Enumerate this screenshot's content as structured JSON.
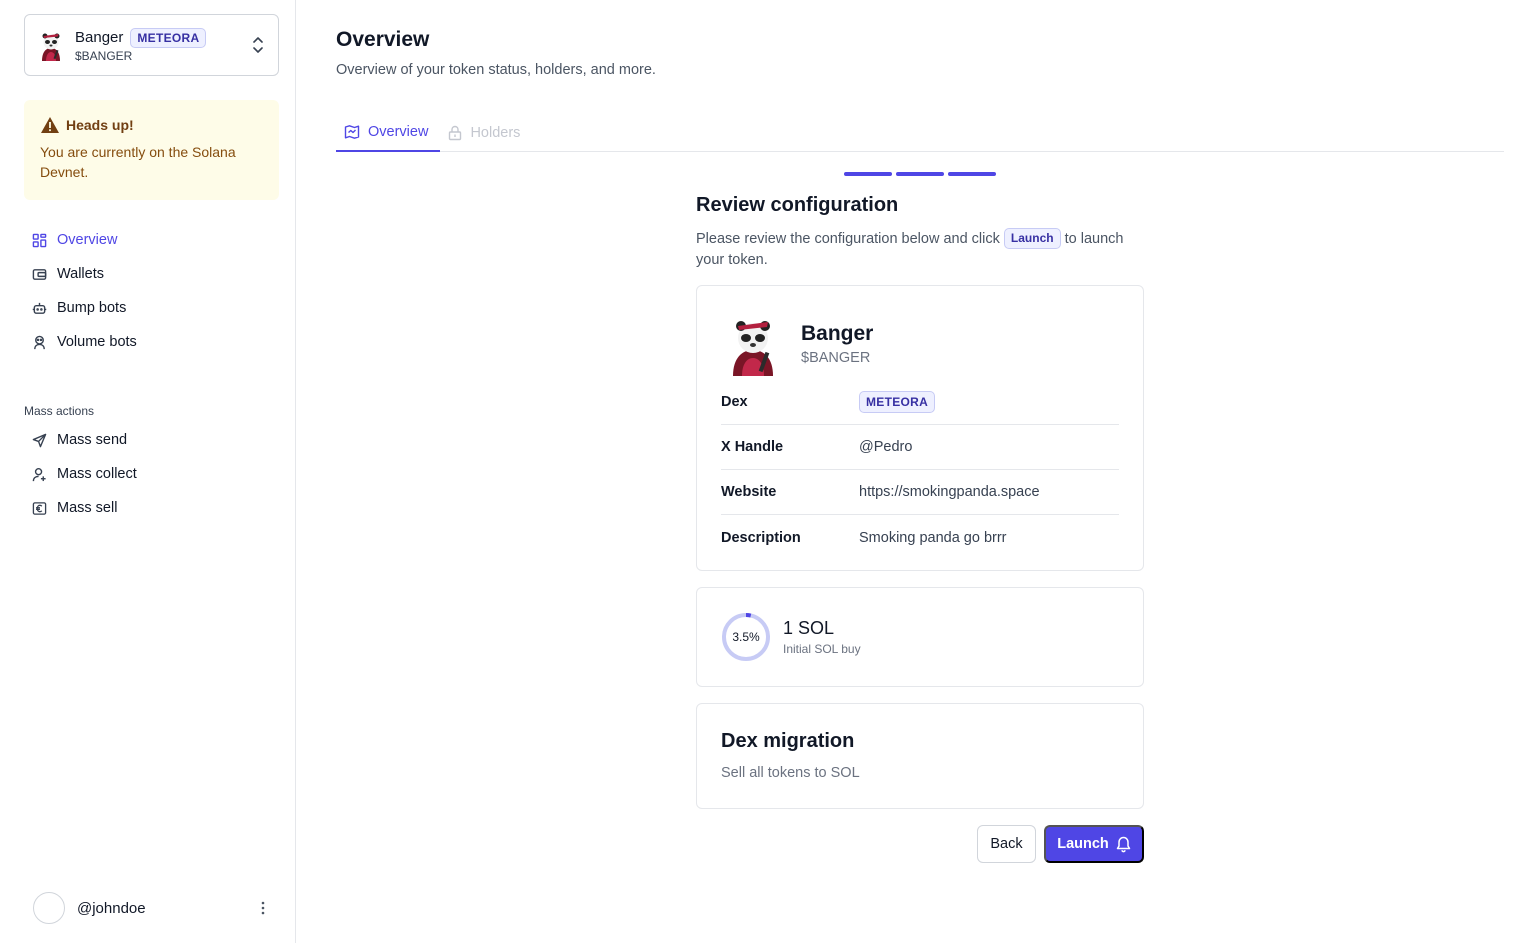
{
  "token": {
    "name": "Banger",
    "symbol": "$BANGER",
    "dex_badge": "METEORA"
  },
  "alert": {
    "title": "Heads up!",
    "body": "You are currently on the Solana Devnet."
  },
  "nav": {
    "items": [
      {
        "label": "Overview",
        "icon": "dashboard-icon",
        "active": true
      },
      {
        "label": "Wallets",
        "icon": "wallet-icon"
      },
      {
        "label": "Bump bots",
        "icon": "bot-icon"
      },
      {
        "label": "Volume bots",
        "icon": "volume-bot-icon"
      }
    ],
    "section_label": "Mass actions",
    "mass_items": [
      {
        "label": "Mass send",
        "icon": "send-icon"
      },
      {
        "label": "Mass collect",
        "icon": "user-plus-icon"
      },
      {
        "label": "Mass sell",
        "icon": "euro-icon"
      }
    ]
  },
  "user": {
    "handle": "@johndoe"
  },
  "page": {
    "title": "Overview",
    "subtitle": "Overview of your token status, holders, and more.",
    "tabs": [
      {
        "label": "Overview",
        "active": true
      },
      {
        "label": "Holders",
        "disabled": true
      }
    ]
  },
  "review": {
    "title": "Review configuration",
    "desc_before": "Please review the configuration below and click",
    "desc_chip": "Launch",
    "desc_after": "to launch your token.",
    "rows": [
      {
        "label": "Dex",
        "value": "METEORA"
      },
      {
        "label": "X Handle",
        "value": "@Pedro"
      },
      {
        "label": "Website",
        "value": "https://smokingpanda.space"
      },
      {
        "label": "Description",
        "value": "Smoking panda go brrr"
      }
    ]
  },
  "buy": {
    "percent_label": "3.5%",
    "percent": 3.5,
    "amount": "1 SOL",
    "caption": "Initial SOL buy"
  },
  "migration": {
    "title": "Dex migration",
    "caption": "Sell all tokens to SOL"
  },
  "actions": {
    "back": "Back",
    "launch": "Launch"
  },
  "colors": {
    "accent": "#4f46e5",
    "alert_bg": "#fefce8",
    "badge_bg": "#eef0ff"
  }
}
